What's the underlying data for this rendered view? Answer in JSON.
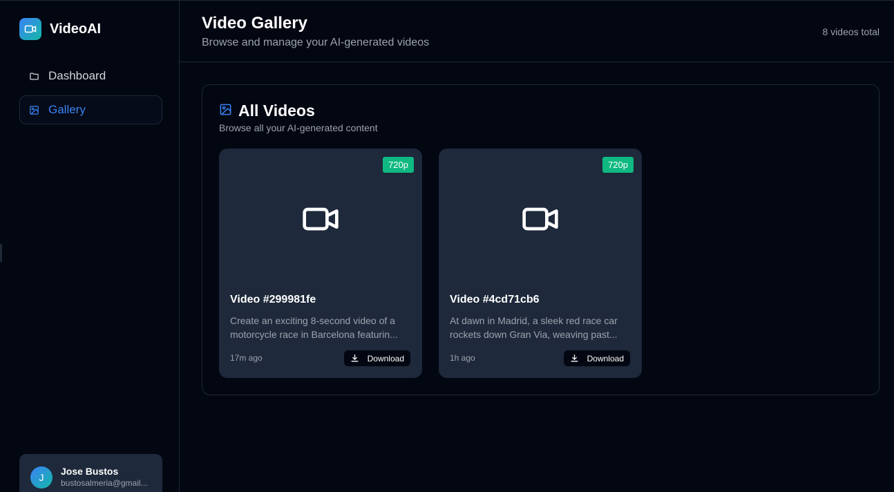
{
  "app": {
    "name": "VideoAI"
  },
  "sidebar": {
    "items": [
      {
        "label": "Dashboard",
        "icon": "folder-icon",
        "active": false
      },
      {
        "label": "Gallery",
        "icon": "image-icon",
        "active": true
      }
    ],
    "user": {
      "initial": "J",
      "name": "Jose Bustos",
      "email": "bustosalmeria@gmail..."
    }
  },
  "header": {
    "title": "Video Gallery",
    "subtitle": "Browse and manage your AI-generated videos",
    "count": "8 videos total"
  },
  "panel": {
    "title": "All Videos",
    "subtitle": "Browse all your AI-generated content",
    "icon": "image-icon"
  },
  "videos": [
    {
      "resolution": "720p",
      "title": "Video #299981fe",
      "desc_line1": "Create an exciting 8-second video of a",
      "desc_line2": "motorcycle race in Barcelona featurin...",
      "time": "17m ago",
      "download_label": "Download"
    },
    {
      "resolution": "720p",
      "title": "Video #4cd71cb6",
      "desc_line1": "At dawn in Madrid, a sleek red race car",
      "desc_line2": "rockets down Gran Via, weaving past...",
      "time": "1h ago",
      "download_label": "Download"
    }
  ],
  "colors": {
    "background": "#030712",
    "card": "#1e293b",
    "accent": "#3b82f6",
    "badge": "#10b981",
    "border": "#1f2937"
  }
}
